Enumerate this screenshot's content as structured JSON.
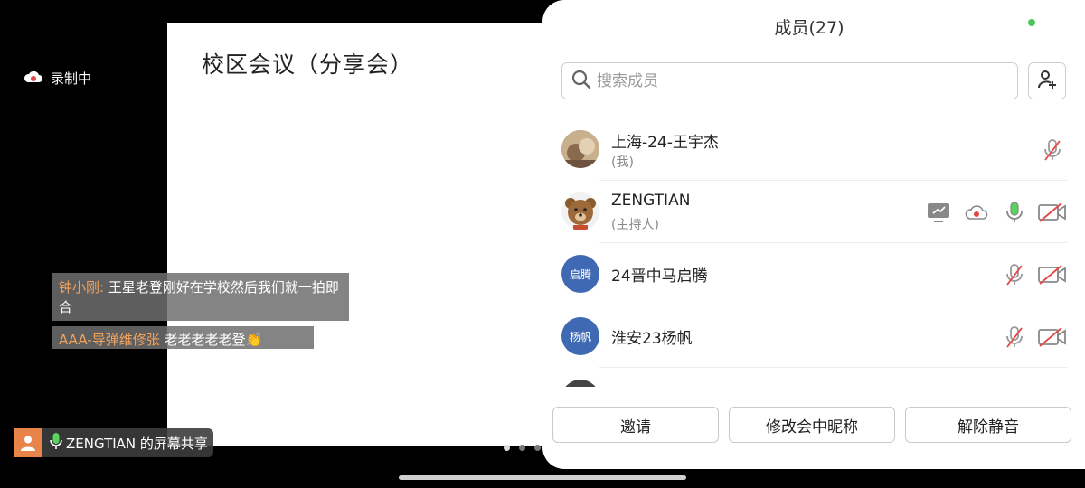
{
  "slide": {
    "title": "校区会议（分享会）"
  },
  "recording": {
    "label": "录制中"
  },
  "chat": [
    {
      "name": "钟小刚:",
      "message": "王星老登刚好在学校然后我们就一拍即合"
    },
    {
      "name": "AAA-导弹维修张",
      "message": "老老老老老登👏"
    }
  ],
  "share_bar": {
    "label": "ZENGTIAN 的屏幕共享"
  },
  "panel": {
    "title": "成员(27)",
    "search_placeholder": "搜索成员",
    "members": [
      {
        "name": "上海-24-王宇杰",
        "role": "(我)"
      },
      {
        "name": "ZENGTIAN",
        "role": "(主持人)"
      },
      {
        "name": "24晋中马启腾",
        "avatar_text": "启腾"
      },
      {
        "name": "淮安23杨帆",
        "avatar_text": "杨帆"
      }
    ],
    "buttons": {
      "invite": "邀请",
      "rename": "修改会中昵称",
      "unmute": "解除静音"
    }
  },
  "colors": {
    "accent_orange": "#f1a35d",
    "status_green": "#4bc35b",
    "mic_active_green": "#5ad35f",
    "muted_red": "#e64545",
    "avatar_blue": "#3f6ab3"
  }
}
